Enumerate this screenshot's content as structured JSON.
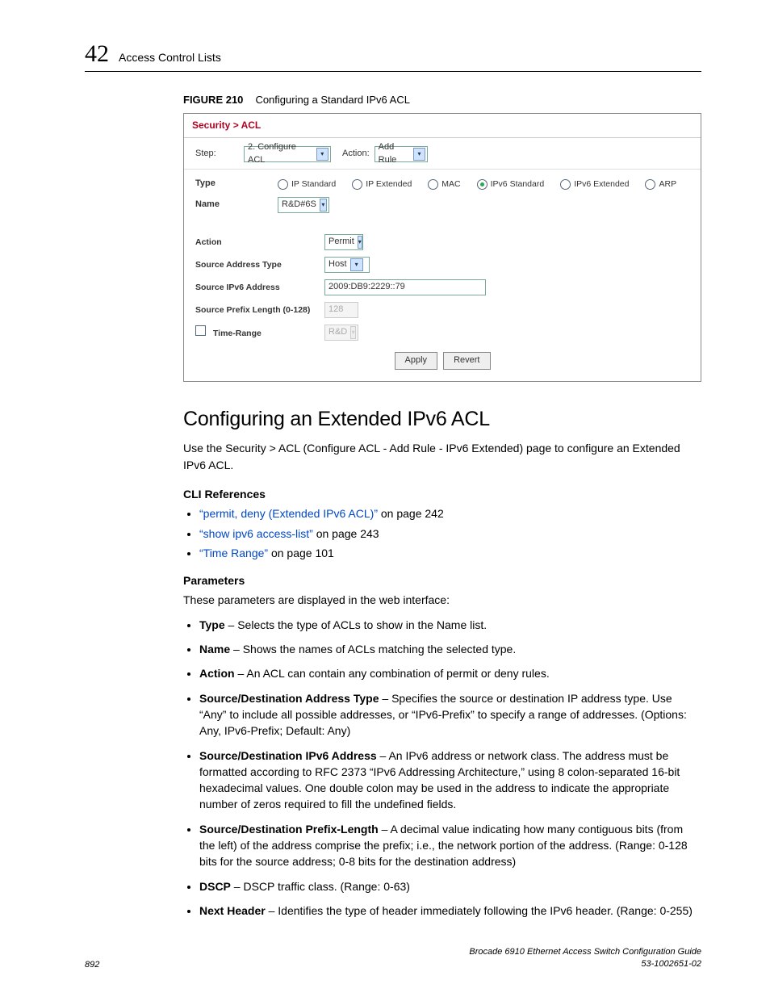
{
  "header": {
    "chapter_num": "42",
    "chapter_title": "Access Control Lists"
  },
  "figure": {
    "label": "FIGURE 210",
    "caption": "Configuring a Standard IPv6 ACL",
    "breadcrumb": "Security > ACL",
    "step_label": "Step:",
    "step_value": "2. Configure ACL",
    "action_label": "Action:",
    "action_value": "Add Rule",
    "type_label": "Type",
    "radios": {
      "ip_std": "IP Standard",
      "ip_ext": "IP Extended",
      "mac": "MAC",
      "ipv6_std": "IPv6 Standard",
      "ipv6_ext": "IPv6 Extended",
      "arp": "ARP"
    },
    "name_label": "Name",
    "name_value": "R&D#6S",
    "rule_action_label": "Action",
    "rule_action_value": "Permit",
    "src_addr_type_label": "Source Address Type",
    "src_addr_type_value": "Host",
    "src_ip_label": "Source IPv6 Address",
    "src_ip_value": "2009:DB9:2229::79",
    "src_prefix_label": "Source Prefix Length (0-128)",
    "src_prefix_value": "128",
    "time_range_label": "Time-Range",
    "time_range_value": "R&D",
    "apply_btn": "Apply",
    "revert_btn": "Revert"
  },
  "section": {
    "title": "Configuring an Extended IPv6 ACL",
    "intro": "Use the Security > ACL (Configure ACL - Add Rule - IPv6 Extended) page to configure an Extended IPv6 ACL.",
    "cli_heading": "CLI References",
    "refs": [
      {
        "link": "“permit, deny (Extended IPv6 ACL)”",
        "page": " on page 242"
      },
      {
        "link": "“show ipv6 access-list”",
        "page": " on page 243"
      },
      {
        "link": "“Time Range”",
        "page": " on page 101"
      }
    ],
    "params_heading": "Parameters",
    "params_intro": "These parameters are displayed in the web interface:",
    "params": [
      {
        "name": "Type",
        "desc": " – Selects the type of ACLs to show in the Name list."
      },
      {
        "name": "Name",
        "desc": " – Shows the names of ACLs matching the selected type."
      },
      {
        "name": "Action",
        "desc": " – An ACL can contain any combination of permit or deny rules."
      },
      {
        "name": "Source/Destination Address Type",
        "desc": " – Specifies the source or destination IP address type. Use “Any” to include all possible addresses, or “IPv6-Prefix” to specify a range of addresses. (Options: Any, IPv6-Prefix; Default: Any)"
      },
      {
        "name": "Source/Destination IPv6 Address",
        "desc": " – An IPv6 address or network class. The address must be formatted according to RFC 2373 “IPv6 Addressing Architecture,” using 8 colon-separated 16-bit hexadecimal values. One double colon may be used in the address to indicate the appropriate number of zeros required to fill the undefined fields."
      },
      {
        "name": "Source/Destination Prefix-Length",
        "desc": " – A decimal value indicating how many contiguous bits (from the left) of the address comprise the prefix; i.e., the network portion of the address. (Range: 0-128 bits for the source address; 0-8 bits for the destination address)"
      },
      {
        "name": "DSCP",
        "desc": " – DSCP traffic class. (Range: 0-63)"
      },
      {
        "name": "Next Header",
        "desc": " – Identifies the type of header immediately following the IPv6 header. (Range: 0-255)"
      }
    ]
  },
  "footer": {
    "page": "892",
    "title": "Brocade 6910 Ethernet Access Switch Configuration Guide",
    "docnum": "53-1002651-02"
  }
}
